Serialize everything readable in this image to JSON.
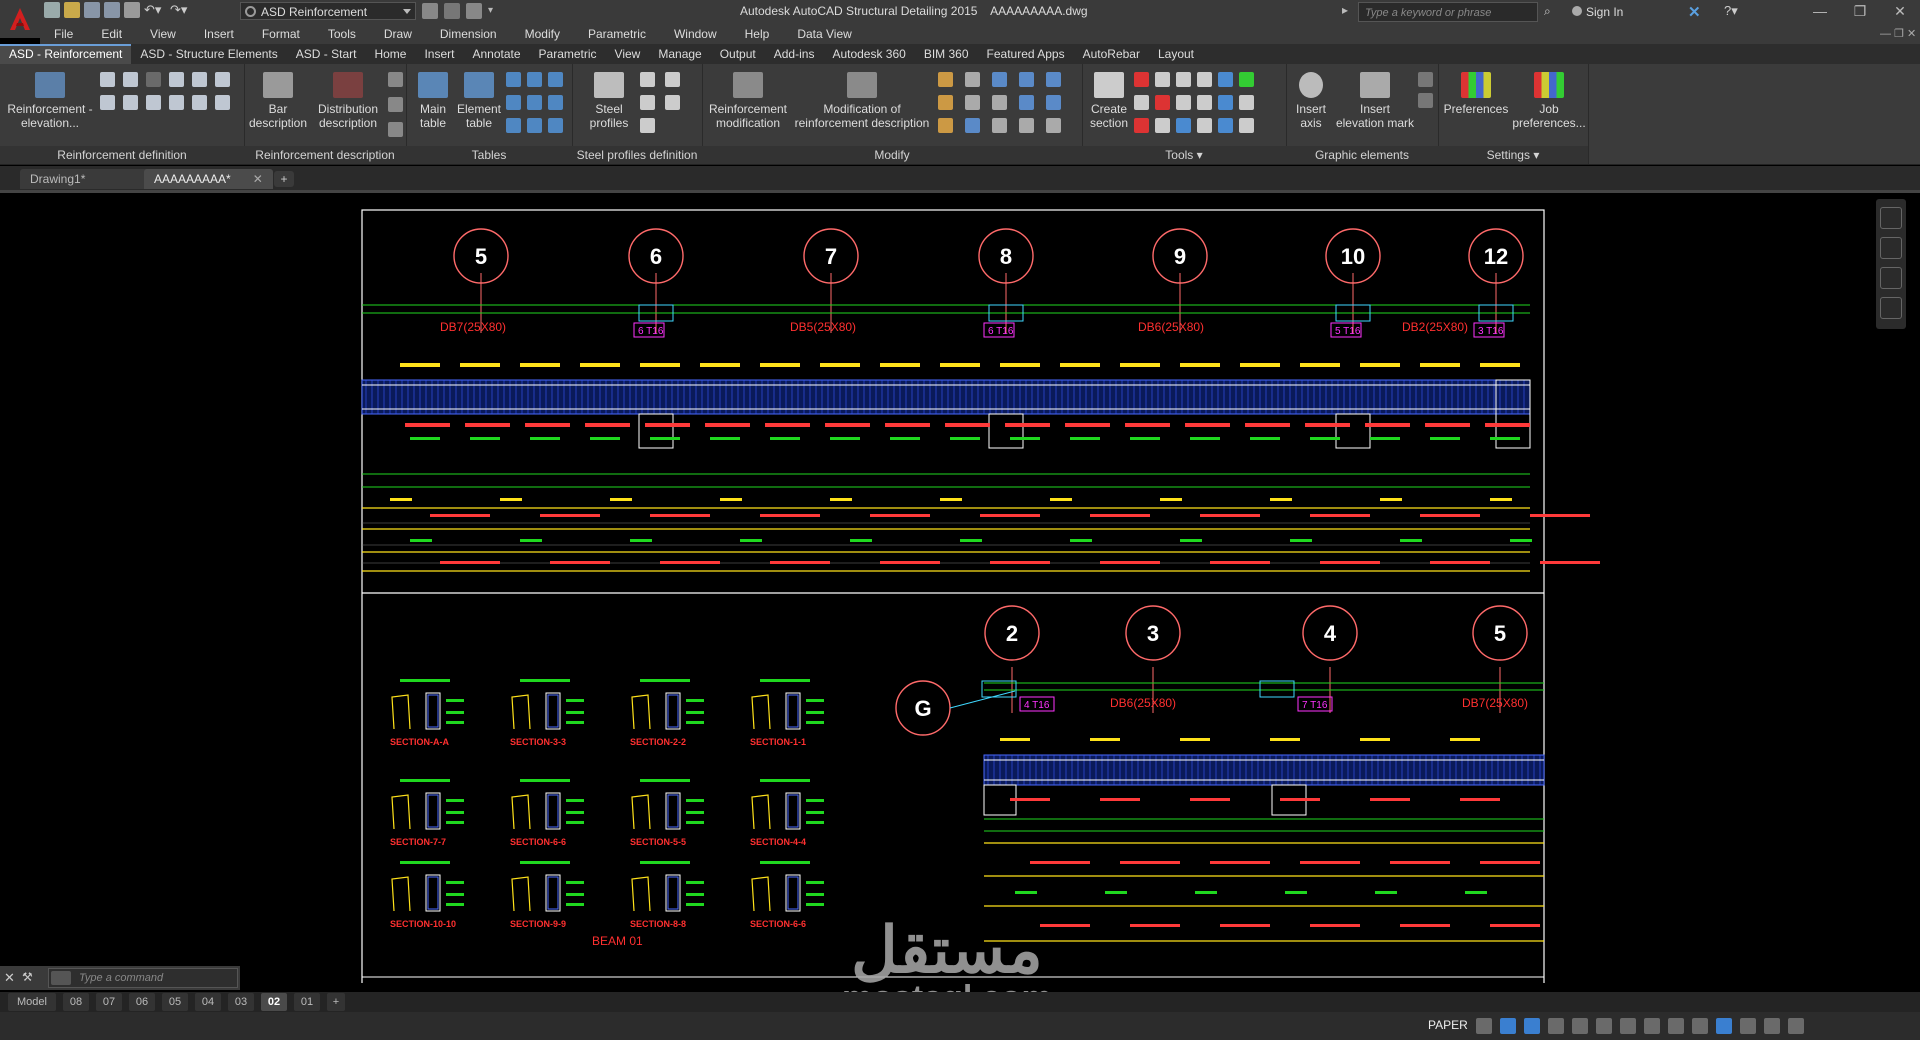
{
  "app": {
    "title": "Autodesk AutoCAD Structural Detailing 2015",
    "file": "AAAAAAAAA.dwg",
    "workspace": "ASD Reinforcement",
    "search_placeholder": "Type a keyword or phrase",
    "sign_in": "Sign In"
  },
  "menu": [
    "File",
    "Edit",
    "View",
    "Insert",
    "Format",
    "Tools",
    "Draw",
    "Dimension",
    "Modify",
    "Parametric",
    "Window",
    "Help",
    "Data View"
  ],
  "ribbon_tabs": [
    "ASD - Reinforcement",
    "ASD - Structure Elements",
    "ASD - Start",
    "Home",
    "Insert",
    "Annotate",
    "Parametric",
    "View",
    "Manage",
    "Output",
    "Add-ins",
    "Autodesk 360",
    "BIM 360",
    "Featured Apps",
    "AutoRebar",
    "Layout"
  ],
  "panels": {
    "reinf_def": {
      "title": "Reinforcement definition",
      "btn": [
        "Reinforcement -",
        "elevation..."
      ]
    },
    "reinf_desc": {
      "title": "Reinforcement description",
      "bar": [
        "Bar",
        "description"
      ],
      "dist": [
        "Distribution",
        "description"
      ]
    },
    "tables": {
      "title": "Tables",
      "main": [
        "Main",
        "table"
      ],
      "element": [
        "Element",
        "table"
      ]
    },
    "steel": {
      "title": "Steel profiles definition",
      "btn": [
        "Steel",
        "profiles"
      ]
    },
    "modify": {
      "title": "Modify",
      "rm": [
        "Reinforcement",
        "modification"
      ],
      "mod": [
        "Modification of",
        "reinforcement description"
      ]
    },
    "tools": {
      "title": "Tools",
      "create": [
        "Create",
        "section"
      ]
    },
    "graphic": {
      "title": "Graphic elements",
      "axis": [
        "Insert",
        "axis"
      ],
      "mark": [
        "Insert",
        "elevation mark"
      ]
    },
    "settings": {
      "title": "Settings",
      "pref": "Preferences",
      "job": [
        "Job",
        "preferences..."
      ]
    }
  },
  "file_tabs": [
    "Drawing1*",
    "AAAAAAAAA*"
  ],
  "drawing": {
    "grid_top": [
      "5",
      "6",
      "7",
      "8",
      "9",
      "10",
      "12"
    ],
    "grid_bottom": [
      "2",
      "3",
      "4",
      "5"
    ],
    "grid_g": "G",
    "beams_top": [
      "DB7(25X80)",
      "DB5(25X80)",
      "DB6(25X80)",
      "DB2(25X80)"
    ],
    "columns_top": [
      "6 T16",
      "6 T16",
      "5 T16",
      "3 T16"
    ],
    "beams_bottom": [
      "DB6(25X80)",
      "DB7(25X80)"
    ],
    "columns_bottom": [
      "4 T16",
      "7 T16"
    ],
    "beam_label": "BEAM 01",
    "section_labels": [
      [
        "SECTION-A-A",
        "SECTION-3-3",
        "SECTION-2-2",
        "SECTION-1-1"
      ],
      [
        "SECTION-7-7",
        "SECTION-6-6",
        "SECTION-5-5",
        "SECTION-4-4"
      ],
      [
        "SECTION-10-10",
        "SECTION-9-9",
        "SECTION-8-8",
        "SECTION-6-6"
      ]
    ]
  },
  "command": {
    "placeholder": "Type a command"
  },
  "layout_tabs": [
    "Model",
    "08",
    "07",
    "06",
    "05",
    "04",
    "03",
    "02",
    "01"
  ],
  "active_layout": "02",
  "status": {
    "space": "PAPER"
  },
  "watermark": {
    "ar": "مستقل",
    "en": "mostaql.com"
  }
}
